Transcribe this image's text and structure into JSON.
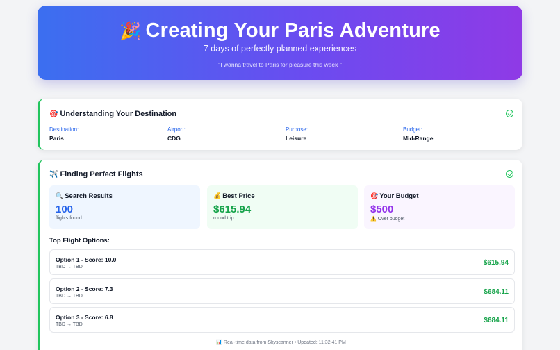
{
  "hero": {
    "icon": "party-popper-icon",
    "emoji": "🎉",
    "title": "Creating Your Paris Adventure",
    "subtitle": "7 days of perfectly planned experiences",
    "quote": "\"I wanna travel to Paris for pleasure this week \""
  },
  "destination_card": {
    "icon": "target-icon",
    "emoji": "🎯",
    "title": "Understanding Your Destination",
    "status_icon": "check-circle-icon",
    "fields": [
      {
        "label": "Destination:",
        "value": "Paris"
      },
      {
        "label": "Airport:",
        "value": "CDG"
      },
      {
        "label": "Purpose:",
        "value": "Leisure"
      },
      {
        "label": "Budget:",
        "value": "Mid-Range"
      }
    ]
  },
  "flights_card": {
    "icon": "airplane-icon",
    "emoji": "✈️",
    "title": "Finding Perfect Flights",
    "status_icon": "check-circle-icon",
    "stats": {
      "search": {
        "icon": "magnifier-icon",
        "emoji": "🔍",
        "title": "Search Results",
        "value": "100",
        "sub": "flights found"
      },
      "price": {
        "icon": "money-bag-icon",
        "emoji": "💰",
        "title": "Best Price",
        "value": "$615.94",
        "sub": "round trip"
      },
      "budget": {
        "icon": "target-icon",
        "emoji": "🎯",
        "title": "Your Budget",
        "value": "$500",
        "warning_emoji": "⚠️",
        "warning_icon": "warning-icon",
        "sub": "Over budget"
      }
    },
    "options_heading": "Top Flight Options:",
    "options": [
      {
        "name": "Option 1 - Score: 10.0",
        "route": "TBD → TBD",
        "price": "$615.94"
      },
      {
        "name": "Option 2 - Score: 7.3",
        "route": "TBD → TBD",
        "price": "$684.11"
      },
      {
        "name": "Option 3 - Score: 6.8",
        "route": "TBD → TBD",
        "price": "$684.11"
      }
    ],
    "footer": {
      "icon": "chart-icon",
      "emoji": "📊",
      "text": "Real-time data from Skyscanner • Updated: 11:32:41 PM"
    }
  },
  "colors": {
    "hero_gradient_start": "#3b6ff0",
    "hero_gradient_end": "#8f3ae6",
    "accent_green": "#22c55e",
    "price_green": "#16a34a",
    "label_blue": "#2563eb",
    "budget_purple": "#9333ea"
  }
}
